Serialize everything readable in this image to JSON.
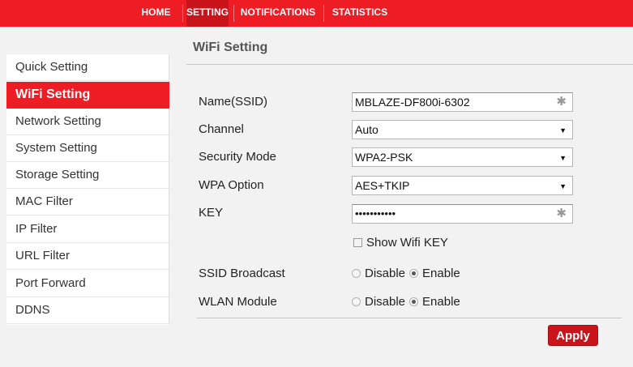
{
  "nav": {
    "items": [
      {
        "label": "HOME",
        "active": false
      },
      {
        "label": "SETTING",
        "active": true
      },
      {
        "label": "NOTIFICATIONS",
        "active": false
      },
      {
        "label": "STATISTICS",
        "active": false
      }
    ]
  },
  "sidebar": {
    "items": [
      {
        "label": "Quick Setting",
        "active": false
      },
      {
        "label": "WiFi Setting",
        "active": true
      },
      {
        "label": "Network Setting",
        "active": false
      },
      {
        "label": "System Setting",
        "active": false
      },
      {
        "label": "Storage Setting",
        "active": false
      },
      {
        "label": "MAC Filter",
        "active": false
      },
      {
        "label": "IP Filter",
        "active": false
      },
      {
        "label": "URL Filter",
        "active": false
      },
      {
        "label": "Port Forward",
        "active": false
      },
      {
        "label": "DDNS",
        "active": false
      }
    ]
  },
  "page": {
    "title": "WiFi Setting"
  },
  "form": {
    "ssid": {
      "label": "Name(SSID)",
      "value": "MBLAZE-DF800i-6302"
    },
    "channel": {
      "label": "Channel",
      "value": "Auto"
    },
    "security_mode": {
      "label": "Security Mode",
      "value": "WPA2-PSK"
    },
    "wpa_option": {
      "label": "WPA Option",
      "value": "AES+TKIP"
    },
    "key": {
      "label": "KEY",
      "value": "•••••••••••"
    },
    "show_key": {
      "label": "Show Wifi KEY",
      "checked": false
    },
    "ssid_broadcast": {
      "label": "SSID Broadcast",
      "options": [
        "Disable",
        "Enable"
      ],
      "selected": "Enable"
    },
    "wlan_module": {
      "label": "WLAN Module",
      "options": [
        "Disable",
        "Enable"
      ],
      "selected": "Enable"
    },
    "required_marker": "✱",
    "dropdown_caret": "▼"
  },
  "actions": {
    "apply_label": "Apply"
  },
  "colors": {
    "accent": "#ee1d23",
    "accent_dark": "#c8141a"
  }
}
